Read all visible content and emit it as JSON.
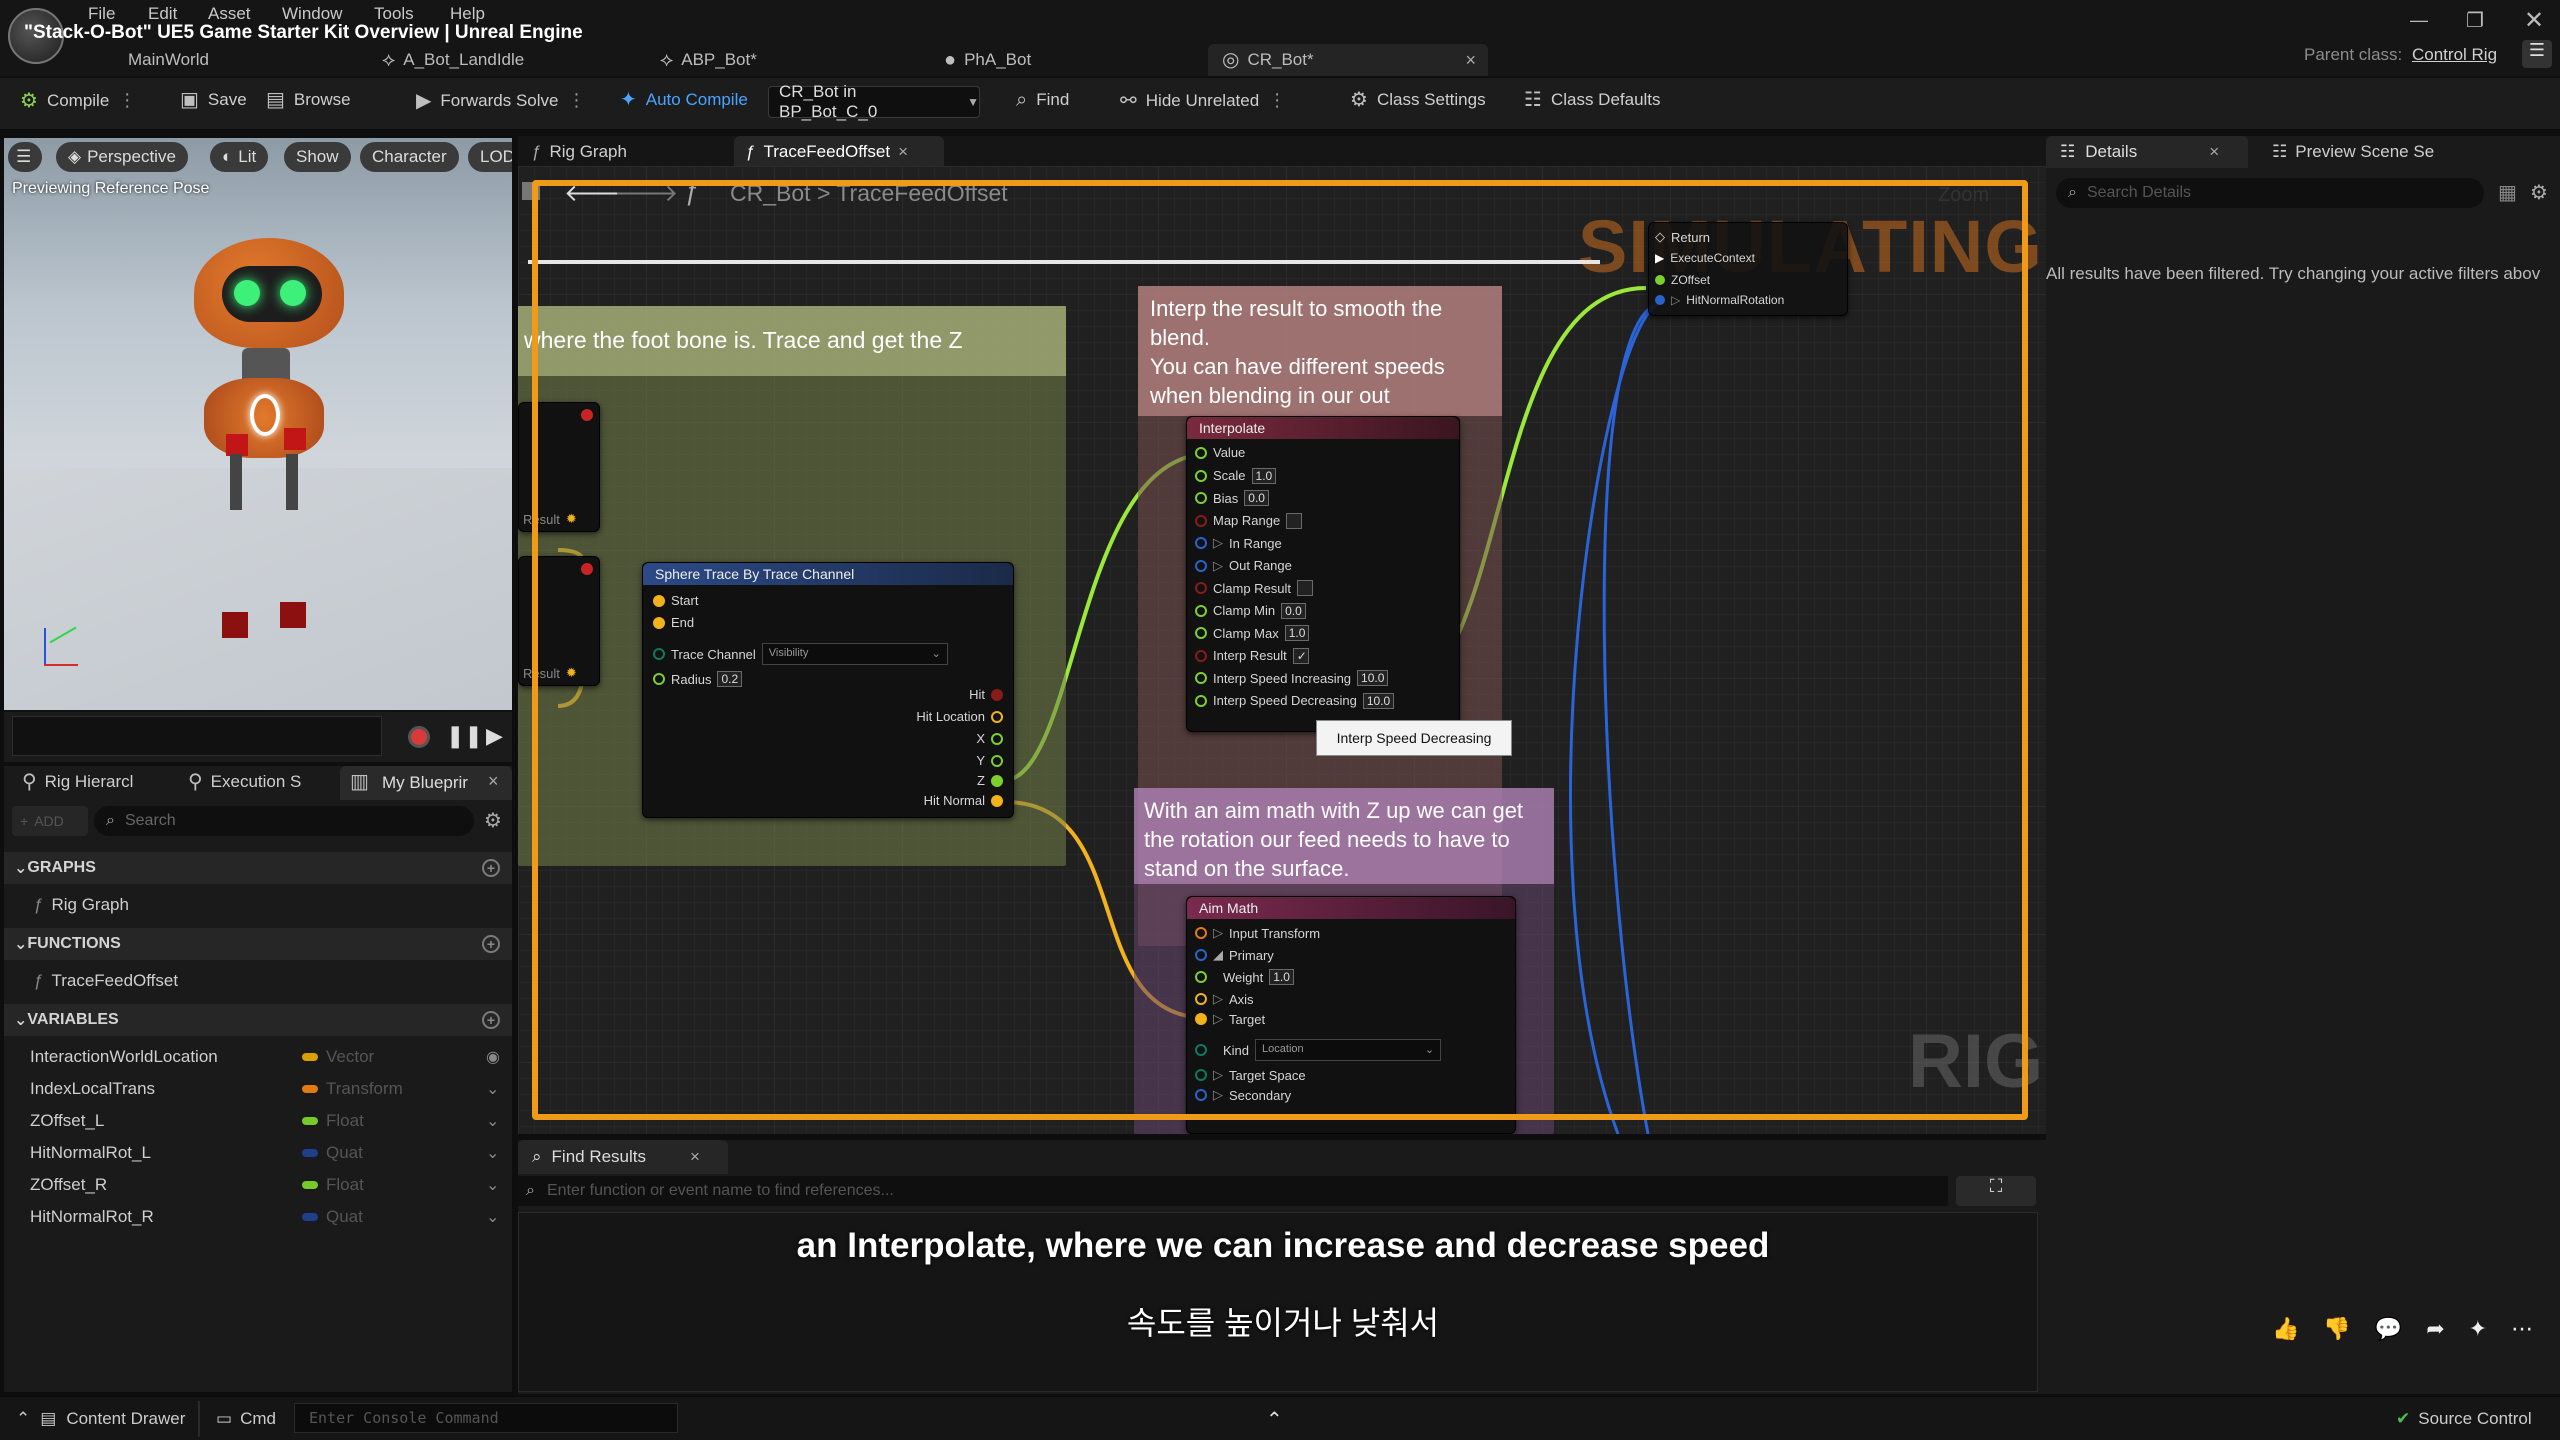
{
  "window": {
    "title": "\"Stack-O-Bot\" UE5 Game Starter Kit Overview | Unreal Engine",
    "parent_class_label": "Parent class:",
    "parent_class_value": "Control Rig"
  },
  "menu": [
    "File",
    "Edit",
    "Asset",
    "Window",
    "Tools",
    "Help"
  ],
  "doc_tabs": [
    {
      "label": "MainWorld"
    },
    {
      "label": "A_Bot_LandIdle"
    },
    {
      "label": "ABP_Bot*"
    },
    {
      "label": "PhA_Bot"
    },
    {
      "label": "CR_Bot*"
    }
  ],
  "toolbar": {
    "compile": "Compile",
    "save": "Save",
    "browse": "Browse",
    "forwards_solve": "Forwards Solve",
    "auto_compile": "Auto Compile",
    "debug_object": "CR_Bot in BP_Bot_C_0",
    "find": "Find",
    "hide_unrelated": "Hide Unrelated",
    "class_settings": "Class Settings",
    "class_defaults": "Class Defaults"
  },
  "viewport": {
    "buttons": [
      "Perspective",
      "Lit",
      "Show",
      "Character",
      "LOD"
    ],
    "overlay": "Previewing Reference Pose"
  },
  "left_tabs": [
    "Rig Hierarcl",
    "Execution S",
    "My Blueprir"
  ],
  "my_blueprint": {
    "add": "ADD",
    "search_placeholder": "Search",
    "graphs_header": "GRAPHS",
    "graphs": [
      "Rig Graph"
    ],
    "functions_header": "FUNCTIONS",
    "functions": [
      "TraceFeedOffset"
    ],
    "variables_header": "VARIABLES",
    "variables": [
      {
        "name": "InteractionWorldLocation",
        "type": "Vector",
        "color": "#d9a000"
      },
      {
        "name": "IndexLocalTrans",
        "type": "Transform",
        "color": "#e07a12"
      },
      {
        "name": "ZOffset_L",
        "type": "Float",
        "color": "#78c92a"
      },
      {
        "name": "HitNormalRot_L",
        "type": "Quat",
        "color": "#1f3f8c"
      },
      {
        "name": "ZOffset_R",
        "type": "Float",
        "color": "#78c92a"
      },
      {
        "name": "HitNormalRot_R",
        "type": "Quat",
        "color": "#1f3f8c"
      }
    ]
  },
  "graph_tabs": [
    "Rig Graph",
    "TraceFeedOffset"
  ],
  "breadcrumb": {
    "root": "CR_Bot",
    "sep": ">",
    "leaf": "TraceFeedOffset"
  },
  "graph": {
    "simulating": "SIMULATING",
    "watermark": "RIG",
    "zoom": "Zoom",
    "comment1": "where the foot bone is. Trace and get the Z",
    "comment2": "Interp the result to smooth the blend.\nYou can have different speeds when blending in our out",
    "comment3": "With an aim math with Z up we can get the rotation our feed needs to have to stand on the surface.",
    "return_node": {
      "title": "Return",
      "pins": [
        "ExecuteContext",
        "ZOffset",
        "HitNormalRotation"
      ]
    },
    "sphere_trace": {
      "title": "Sphere Trace By Trace Channel",
      "start": "Start",
      "end": "End",
      "trace_channel": "Trace Channel",
      "trace_value": "Visibility",
      "radius": "Radius",
      "radius_value": "0.2",
      "hit": "Hit",
      "hit_location": "Hit Location",
      "x": "X",
      "y": "Y",
      "z": "Z",
      "hit_normal": "Hit Normal"
    },
    "result_labels": [
      "Result",
      "Result"
    ],
    "interpolate": {
      "title": "Interpolate",
      "pins": [
        {
          "label": "Value",
          "val": ""
        },
        {
          "label": "Scale",
          "val": "1.0"
        },
        {
          "label": "Bias",
          "val": "0.0"
        },
        {
          "label": "Map Range",
          "val": "",
          "check": "false"
        },
        {
          "label": "In Range",
          "val": ""
        },
        {
          "label": "Out Range",
          "val": ""
        },
        {
          "label": "Clamp Result",
          "val": "",
          "check": "false"
        },
        {
          "label": "Clamp Min",
          "val": "0.0"
        },
        {
          "label": "Clamp Max",
          "val": "1.0"
        },
        {
          "label": "Interp Result",
          "val": "",
          "check": "true"
        },
        {
          "label": "Interp Speed Increasing",
          "val": "10.0"
        },
        {
          "label": "Interp Speed Decreasing",
          "val": "10.0"
        }
      ]
    },
    "tooltip": "Interp Speed Decreasing",
    "aim_math": {
      "title": "Aim Math",
      "pins": [
        "Input Transform",
        "Primary",
        "Weight",
        "Axis",
        "Target",
        "Kind",
        "Target Space",
        "Secondary"
      ],
      "weight": "1.0",
      "kind_value": "Location"
    }
  },
  "find_results": {
    "tab": "Find Results",
    "placeholder": "Enter function or event name to find references..."
  },
  "subtitles": {
    "en": "an Interpolate, where we can increase and decrease speed",
    "ko": "속도를 높이거나 낮춰서"
  },
  "details": {
    "tabs": [
      "Details",
      "Preview Scene Se"
    ],
    "search_placeholder": "Search Details",
    "message": "All results have been filtered. Try changing your active filters abov"
  },
  "statusbar": {
    "content_drawer": "Content Drawer",
    "cmd": "Cmd",
    "console_placeholder": "Enter Console Command",
    "source_control": "Source Control"
  }
}
